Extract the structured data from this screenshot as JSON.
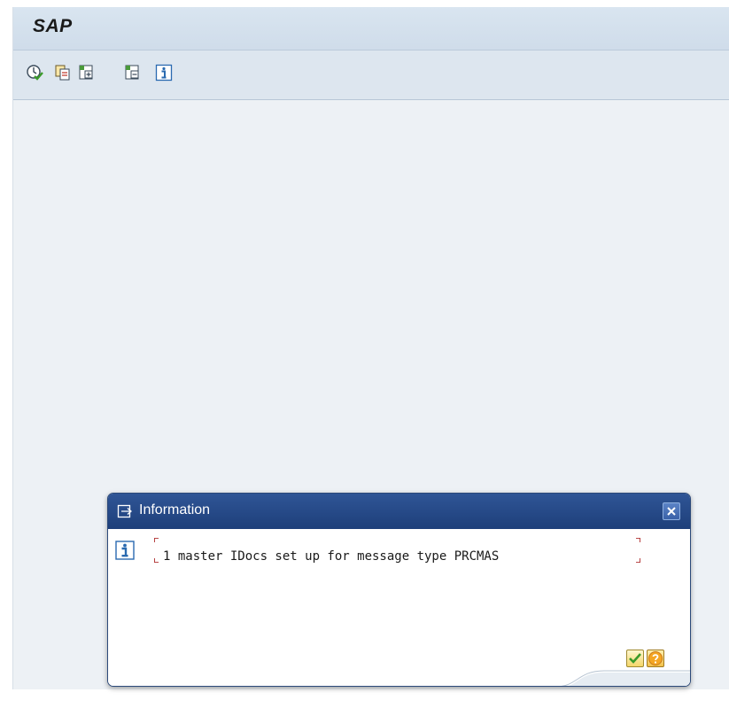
{
  "app": {
    "title": "SAP"
  },
  "toolbar": {
    "icons": [
      "execute-icon",
      "copy-icon",
      "expand-icon",
      "collapse-icon",
      "info-icon"
    ]
  },
  "dialog": {
    "title": "Information",
    "message": "1 master IDocs set up for message type PRCMAS",
    "buttons": {
      "confirm_icon": "check-icon",
      "help_icon": "help-icon"
    }
  },
  "colors": {
    "dialog_header": "#2a4f8f",
    "main_background": "#edf1f5",
    "toolbar_background": "#dde6ef"
  }
}
